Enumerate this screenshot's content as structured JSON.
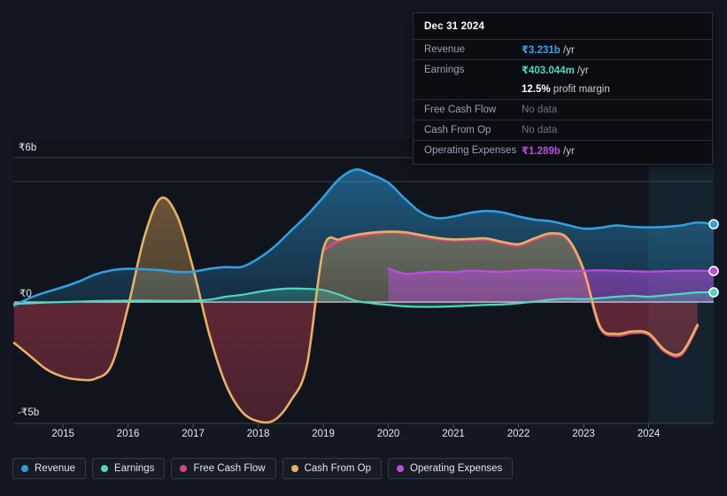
{
  "tooltip": {
    "date": "Dec 31 2024",
    "rows": [
      {
        "label": "Revenue",
        "value": "₹3.231b",
        "unit": "/yr",
        "color": "#3ba3e8",
        "nodata": false
      },
      {
        "label": "Earnings",
        "value": "₹403.044m",
        "unit": "/yr",
        "color": "#4fd6bb",
        "nodata": false
      },
      {
        "label": "",
        "value": "12.5%",
        "unit": "profit margin",
        "color": "#ffffff",
        "nodata": false
      },
      {
        "label": "Free Cash Flow",
        "value": "No data",
        "unit": "",
        "color": "#6b7280",
        "nodata": true
      },
      {
        "label": "Cash From Op",
        "value": "No data",
        "unit": "",
        "color": "#6b7280",
        "nodata": true
      },
      {
        "label": "Operating Expenses",
        "value": "₹1.289b",
        "unit": "/yr",
        "color": "#c24ae8",
        "nodata": false
      }
    ]
  },
  "axes": {
    "y_top": "₹6b",
    "y_zero": "₹0",
    "y_bottom": "-₹5b",
    "x_ticks": [
      "2015",
      "2016",
      "2017",
      "2018",
      "2019",
      "2020",
      "2021",
      "2022",
      "2023",
      "2024"
    ]
  },
  "legend": [
    {
      "label": "Revenue",
      "color": "#2f9fe0"
    },
    {
      "label": "Earnings",
      "color": "#4fd6bb"
    },
    {
      "label": "Free Cash Flow",
      "color": "#d8447e"
    },
    {
      "label": "Cash From Op",
      "color": "#e8b160"
    },
    {
      "label": "Operating Expenses",
      "color": "#c24ae8"
    }
  ],
  "chart_data": {
    "type": "area",
    "title": "",
    "xlabel": "",
    "ylabel": "",
    "currency": "INR",
    "ylim": [
      -5.6,
      6.6
    ],
    "ytick_values": [
      6,
      0,
      -5
    ],
    "ytick_labels": [
      "₹6b",
      "₹0",
      "-₹5b"
    ],
    "xlim": [
      2014.25,
      2025.0
    ],
    "grid": true,
    "legend_position": "bottom",
    "forecast_start": 2024.0,
    "x": [
      2014.25,
      2014.5,
      2014.75,
      2015.0,
      2015.25,
      2015.5,
      2015.75,
      2016.0,
      2016.25,
      2016.5,
      2016.75,
      2017.0,
      2017.25,
      2017.5,
      2017.75,
      2018.0,
      2018.25,
      2018.5,
      2018.75,
      2019.0,
      2019.25,
      2019.5,
      2019.75,
      2020.0,
      2020.25,
      2020.5,
      2020.75,
      2021.0,
      2021.25,
      2021.5,
      2021.75,
      2022.0,
      2022.25,
      2022.5,
      2022.75,
      2023.0,
      2023.25,
      2023.5,
      2023.75,
      2024.0,
      2024.25,
      2024.5,
      2024.75,
      2025.0
    ],
    "series": [
      {
        "name": "Revenue",
        "color": "#2f9fe0",
        "values": [
          -0.15,
          0.18,
          0.42,
          0.62,
          0.86,
          1.15,
          1.32,
          1.38,
          1.36,
          1.32,
          1.25,
          1.26,
          1.38,
          1.45,
          1.46,
          1.8,
          2.3,
          2.95,
          3.6,
          4.35,
          5.12,
          5.5,
          5.28,
          4.95,
          4.3,
          3.72,
          3.48,
          3.55,
          3.7,
          3.78,
          3.72,
          3.55,
          3.42,
          3.35,
          3.2,
          3.05,
          3.08,
          3.18,
          3.12,
          3.1,
          3.12,
          3.18,
          3.3,
          3.231
        ]
      },
      {
        "name": "Earnings",
        "color": "#4fd6bb",
        "values": [
          -0.08,
          -0.05,
          -0.02,
          0.0,
          0.02,
          0.04,
          0.05,
          0.06,
          0.06,
          0.05,
          0.05,
          0.06,
          0.1,
          0.22,
          0.3,
          0.42,
          0.52,
          0.56,
          0.55,
          0.5,
          0.3,
          0.05,
          -0.05,
          -0.12,
          -0.18,
          -0.2,
          -0.2,
          -0.18,
          -0.15,
          -0.12,
          -0.1,
          -0.05,
          0.02,
          0.1,
          0.14,
          0.12,
          0.16,
          0.22,
          0.26,
          0.22,
          0.28,
          0.34,
          0.4,
          0.403
        ]
      },
      {
        "name": "Free Cash Flow",
        "color": "#d8447e",
        "values": [
          null,
          null,
          null,
          null,
          null,
          null,
          null,
          null,
          null,
          null,
          null,
          null,
          null,
          null,
          null,
          null,
          null,
          null,
          null,
          2.15,
          2.55,
          2.72,
          2.82,
          2.88,
          2.85,
          2.74,
          2.62,
          2.56,
          2.58,
          2.6,
          2.45,
          2.35,
          2.6,
          2.8,
          2.6,
          1.3,
          -1.05,
          -1.38,
          -1.28,
          -1.35,
          -2.05,
          -2.18,
          -1.0,
          null
        ]
      },
      {
        "name": "Cash From Op",
        "color": "#e8b160",
        "values": [
          -1.7,
          -2.25,
          -2.8,
          -3.1,
          -3.22,
          -3.18,
          -2.6,
          -0.2,
          2.7,
          4.3,
          3.6,
          1.4,
          -1.35,
          -3.4,
          -4.55,
          -4.95,
          -4.9,
          -4.1,
          -2.6,
          2.18,
          2.6,
          2.78,
          2.88,
          2.92,
          2.9,
          2.78,
          2.66,
          2.6,
          2.62,
          2.64,
          2.5,
          2.4,
          2.65,
          2.85,
          2.65,
          1.35,
          -1.0,
          -1.32,
          -1.22,
          -1.3,
          -2.0,
          -2.12,
          -0.95,
          null
        ]
      },
      {
        "name": "Operating Expenses",
        "color": "#c24ae8",
        "values": [
          null,
          null,
          null,
          null,
          null,
          null,
          null,
          null,
          null,
          null,
          null,
          null,
          null,
          null,
          null,
          null,
          null,
          null,
          null,
          null,
          null,
          null,
          null,
          1.38,
          1.18,
          1.22,
          1.26,
          1.24,
          1.3,
          1.28,
          1.26,
          1.3,
          1.34,
          1.32,
          1.28,
          1.3,
          1.32,
          1.3,
          1.28,
          1.26,
          1.28,
          1.3,
          1.3,
          1.289
        ]
      }
    ],
    "endpoints": [
      {
        "name": "Revenue",
        "value": 3.231,
        "color": "#2f9fe0"
      },
      {
        "name": "Operating Expenses",
        "value": 1.289,
        "color": "#c24ae8"
      },
      {
        "name": "Earnings",
        "value": 0.403,
        "color": "#4fd6bb"
      }
    ]
  }
}
